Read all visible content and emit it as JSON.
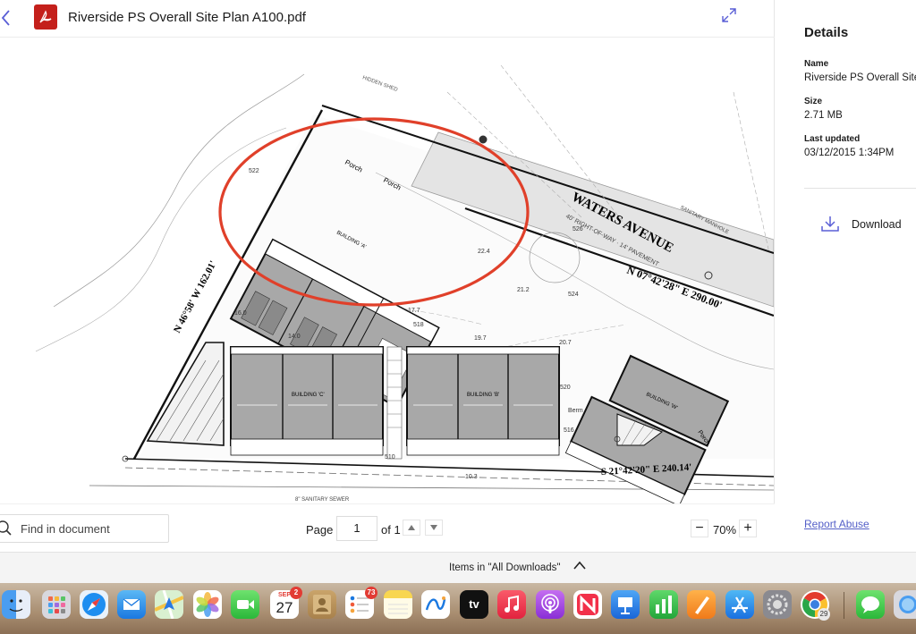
{
  "viewer": {
    "file_name": "Riverside PS Overall Site Plan A100.pdf",
    "find_placeholder": "Find in document",
    "page_label": "Page",
    "page_value": "1",
    "page_of": "of 1",
    "zoom_level": "70%",
    "zoom_out_label": "−",
    "zoom_in_label": "+"
  },
  "drawing": {
    "street_name": "WATERS AVENUE",
    "bearing_north": "N 07°42'28\" E 290.00'",
    "bearing_south": "S 21°42'20\" E 240.14'",
    "bearing_west": "N 46°58' W 162.01'",
    "row_note": "40' RIGHT-OF-WAY · 14' PAVEMENT",
    "building_a": "BUILDING 'A'",
    "building_b": "BUILDING 'B'",
    "building_c": "BUILDING 'C'",
    "building_w": "BUILDING 'W'",
    "porch_1": "Porch",
    "porch_2": "Porch",
    "porch_3": "Porch",
    "sanitary_note": "SANITARY MANHOLE",
    "sewer_note": "8\" SANITARY SEWER",
    "hidden_shed": "HIDDEN SHED",
    "berm_label": "Berm",
    "spot_elevations": [
      "522",
      "520",
      "518",
      "516",
      "524",
      "526",
      "510",
      "14.0",
      "17.7",
      "19.7",
      "20.7",
      "22.4",
      "21.2",
      "16.0",
      "10.3"
    ],
    "highlight_color": "#e0402a"
  },
  "details": {
    "heading": "Details",
    "name_label": "Name",
    "name_value": "Riverside PS Overall Site Plan A100.pdf",
    "size_label": "Size",
    "size_value": "2.71 MB",
    "updated_label": "Last updated",
    "updated_value": "03/12/2015 1:34PM",
    "download_label": "Download",
    "report_label": "Report Abuse"
  },
  "downloads_bar": {
    "label": "Items in \"All Downloads\""
  },
  "dock": {
    "calendar_month": "SEP",
    "calendar_day": "27",
    "calendar_badge": "2",
    "reminders_badge": "73",
    "chrome_badge": "29",
    "tv_label": "tv",
    "apps": [
      "Finder",
      "Launchpad",
      "Safari",
      "Mail",
      "Maps",
      "Photos",
      "FaceTime",
      "Calendar",
      "Contacts",
      "Reminders",
      "Notes",
      "Freeform",
      "TV",
      "Music",
      "Podcasts",
      "News",
      "Keynote",
      "Numbers",
      "Pages",
      "App Store",
      "System Settings",
      "Chrome",
      "Messages",
      "Preview"
    ]
  },
  "colors": {
    "accent": "#5a5fd6",
    "pdf_red": "#c4201b",
    "link": "#5560c8"
  }
}
